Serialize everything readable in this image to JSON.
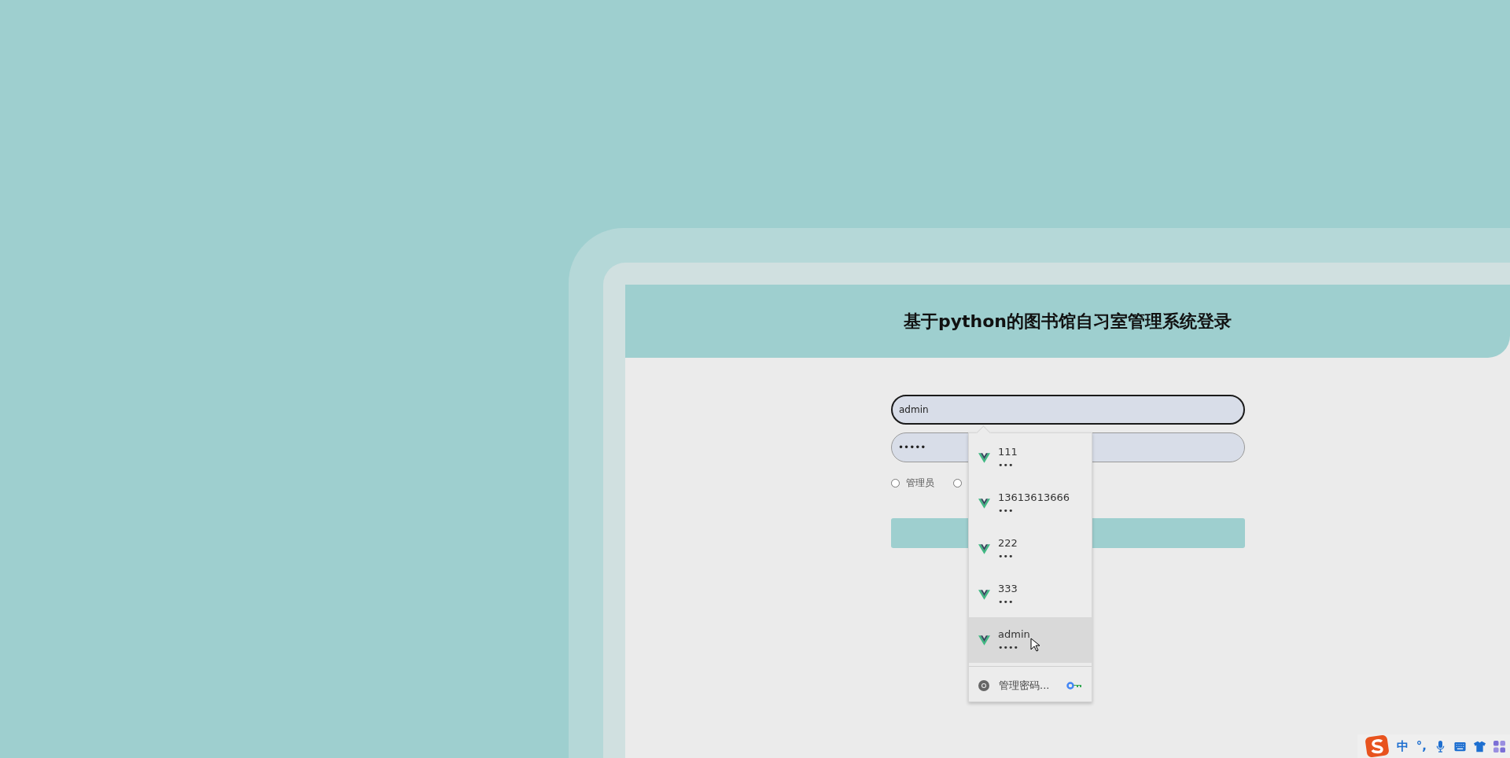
{
  "header": {
    "title": "基于python的图书馆自习室管理系统登录"
  },
  "login_form": {
    "username": {
      "value": "admin",
      "focused": true
    },
    "password": {
      "value": "•••••"
    },
    "roles": [
      {
        "label": "管理员",
        "selected": false
      },
      {
        "selected": false
      }
    ]
  },
  "autofill_menu": {
    "items": [
      {
        "username": "111",
        "password": "•••",
        "selected": false
      },
      {
        "username": "13613613666",
        "password": "•••",
        "selected": false
      },
      {
        "username": "222",
        "password": "•••",
        "selected": false
      },
      {
        "username": "333",
        "password": "•••",
        "selected": false
      },
      {
        "username": "admin",
        "password": "••••",
        "selected": true
      }
    ],
    "manage_link": "管理密码..."
  },
  "ime_toolbar": {
    "mode": "中",
    "punctuation": "°,"
  }
}
